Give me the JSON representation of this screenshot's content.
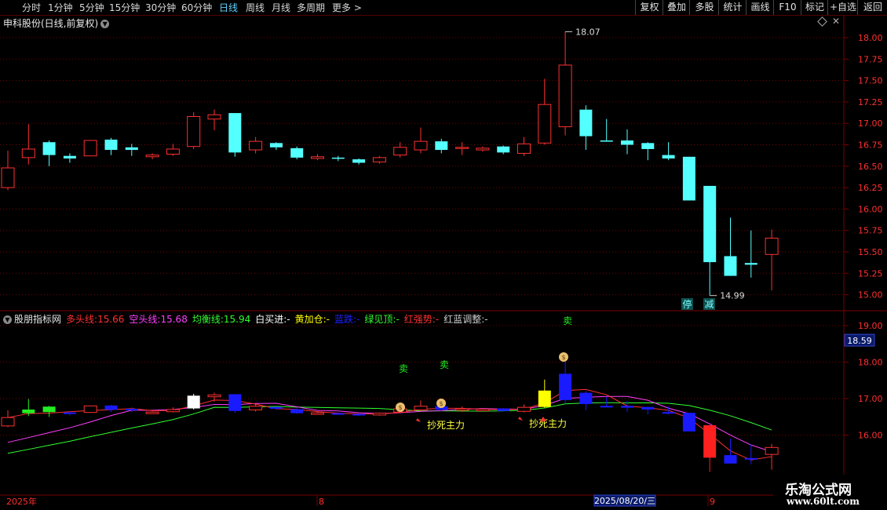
{
  "toolbar": {
    "periods": [
      "分时",
      "1分钟",
      "5分钟",
      "15分钟",
      "30分钟",
      "60分钟",
      "日线",
      "周线",
      "月线",
      "多周期",
      "更多 >"
    ],
    "active_period": "日线",
    "buttons": [
      "复权",
      "叠加",
      "多股",
      "统计",
      "画线",
      "F10",
      "标记",
      "+自选",
      "返回"
    ]
  },
  "main_chart": {
    "title": "申科股份(日线,前复权)",
    "price_axis": [
      "18.00",
      "17.75",
      "17.50",
      "17.25",
      "17.00",
      "16.75",
      "16.50",
      "16.25",
      "16.00",
      "15.75",
      "15.50",
      "15.25",
      "15.00"
    ],
    "high_label": "18.07",
    "low_label": "14.99",
    "badges": [
      "停",
      "减"
    ]
  },
  "sub_chart": {
    "indicator_name": "股朋指标网",
    "legend": [
      {
        "label": "多头线:",
        "value": "15.66",
        "color": "#ff3030"
      },
      {
        "label": "空头线:",
        "value": "15.68",
        "color": "#ff40ff"
      },
      {
        "label": "均衡线:",
        "value": "15.94",
        "color": "#30ff30"
      },
      {
        "label": "白买进:",
        "value": "-",
        "color": "#ffffff"
      },
      {
        "label": "黄加仓:",
        "value": "-",
        "color": "#ffff00"
      },
      {
        "label": "蓝跌:",
        "value": "-",
        "color": "#2020ff"
      },
      {
        "label": "绿见顶:",
        "value": "-",
        "color": "#30ff30"
      },
      {
        "label": "红强势:",
        "value": "-",
        "color": "#ff3030"
      },
      {
        "label": "红蓝调整:",
        "value": "-",
        "color": "#cccccc"
      }
    ],
    "axis": [
      "19.00",
      "18.00",
      "17.00",
      "16.00"
    ],
    "current_price": "18.59",
    "sell_labels": [
      "卖",
      "卖",
      "卖"
    ],
    "buy_labels": [
      "抄死主力",
      "抄死主力"
    ]
  },
  "date_axis": {
    "labels": [
      "2025年",
      "8",
      "9"
    ],
    "cursor_date": "2025/08/20/三"
  },
  "watermark": {
    "title": "乐淘公式网",
    "url": "www.60lt.com"
  },
  "colors": {
    "up": "#ff3030",
    "down": "#54ffff",
    "grid": "#770000",
    "axis_text": "#ff3030"
  },
  "chart_data": {
    "type": "candlestick",
    "title": "申科股份(日线,前复权)",
    "ylim": [
      14.85,
      18.2
    ],
    "candles": [
      {
        "o": 16.25,
        "c": 16.48,
        "h": 16.68,
        "l": 16.22
      },
      {
        "o": 16.6,
        "c": 16.7,
        "h": 16.99,
        "l": 16.52
      },
      {
        "o": 16.78,
        "c": 16.63,
        "h": 16.8,
        "l": 16.5
      },
      {
        "o": 16.62,
        "c": 16.59,
        "h": 16.65,
        "l": 16.54
      },
      {
        "o": 16.62,
        "c": 16.8,
        "h": 16.8,
        "l": 16.62
      },
      {
        "o": 16.81,
        "c": 16.69,
        "h": 16.83,
        "l": 16.63
      },
      {
        "o": 16.72,
        "c": 16.69,
        "h": 16.76,
        "l": 16.62
      },
      {
        "o": 16.61,
        "c": 16.63,
        "h": 16.65,
        "l": 16.58
      },
      {
        "o": 16.64,
        "c": 16.7,
        "h": 16.76,
        "l": 16.62
      },
      {
        "o": 16.73,
        "c": 17.08,
        "h": 17.13,
        "l": 16.7
      },
      {
        "o": 17.05,
        "c": 17.1,
        "h": 17.16,
        "l": 16.92
      },
      {
        "o": 17.12,
        "c": 16.66,
        "h": 17.12,
        "l": 16.61
      },
      {
        "o": 16.69,
        "c": 16.79,
        "h": 16.84,
        "l": 16.65
      },
      {
        "o": 16.77,
        "c": 16.72,
        "h": 16.78,
        "l": 16.69
      },
      {
        "o": 16.71,
        "c": 16.6,
        "h": 16.73,
        "l": 16.58
      },
      {
        "o": 16.59,
        "c": 16.61,
        "h": 16.64,
        "l": 16.57
      },
      {
        "o": 16.6,
        "c": 16.59,
        "h": 16.62,
        "l": 16.56
      },
      {
        "o": 16.58,
        "c": 16.54,
        "h": 16.59,
        "l": 16.52
      },
      {
        "o": 16.55,
        "c": 16.6,
        "h": 16.62,
        "l": 16.53
      },
      {
        "o": 16.63,
        "c": 16.72,
        "h": 16.78,
        "l": 16.6
      },
      {
        "o": 16.69,
        "c": 16.79,
        "h": 16.95,
        "l": 16.65
      },
      {
        "o": 16.79,
        "c": 16.69,
        "h": 16.82,
        "l": 16.65
      },
      {
        "o": 16.71,
        "c": 16.72,
        "h": 16.78,
        "l": 16.63
      },
      {
        "o": 16.69,
        "c": 16.71,
        "h": 16.73,
        "l": 16.67
      },
      {
        "o": 16.73,
        "c": 16.66,
        "h": 16.74,
        "l": 16.64
      },
      {
        "o": 16.65,
        "c": 16.76,
        "h": 16.84,
        "l": 16.62
      },
      {
        "o": 16.77,
        "c": 17.22,
        "h": 17.52,
        "l": 16.75
      },
      {
        "o": 16.96,
        "c": 17.68,
        "h": 18.07,
        "l": 16.86
      },
      {
        "o": 17.16,
        "c": 16.85,
        "h": 17.21,
        "l": 16.69
      },
      {
        "o": 16.8,
        "c": 16.79,
        "h": 17.05,
        "l": 16.79
      },
      {
        "o": 16.8,
        "c": 16.75,
        "h": 16.93,
        "l": 16.64
      },
      {
        "o": 16.77,
        "c": 16.7,
        "h": 16.78,
        "l": 16.57
      },
      {
        "o": 16.63,
        "c": 16.59,
        "h": 16.78,
        "l": 16.57
      },
      {
        "o": 16.61,
        "c": 16.1,
        "h": 16.61,
        "l": 16.1
      },
      {
        "o": 16.27,
        "c": 15.38,
        "h": 16.27,
        "l": 14.99
      },
      {
        "o": 15.45,
        "c": 15.22,
        "h": 15.9,
        "l": 15.22
      },
      {
        "o": 15.37,
        "c": 15.35,
        "h": 15.75,
        "l": 15.2
      },
      {
        "o": 15.47,
        "c": 15.66,
        "h": 15.76,
        "l": 15.05
      }
    ]
  }
}
